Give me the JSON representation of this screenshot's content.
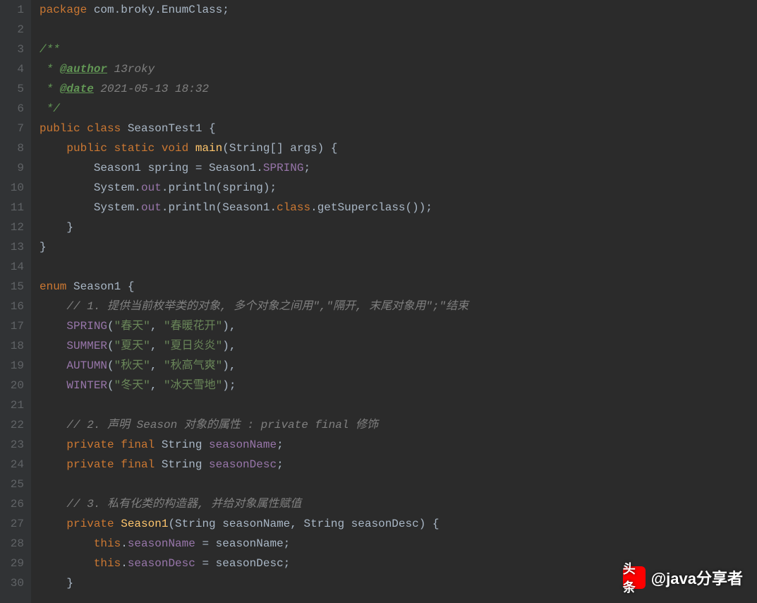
{
  "code": {
    "lines": [
      {
        "n": 1,
        "tokens": [
          [
            "kw",
            "package"
          ],
          [
            "punct",
            " com.broky.EnumClass;"
          ]
        ]
      },
      {
        "n": 2,
        "tokens": []
      },
      {
        "n": 3,
        "tokens": [
          [
            "doc",
            "/**"
          ]
        ]
      },
      {
        "n": 4,
        "tokens": [
          [
            "doc",
            " * "
          ],
          [
            "doctag",
            "@author"
          ],
          [
            "docval",
            " 13roky"
          ]
        ]
      },
      {
        "n": 5,
        "tokens": [
          [
            "doc",
            " * "
          ],
          [
            "doctag",
            "@date"
          ],
          [
            "docval",
            " 2021-05-13 18:32"
          ]
        ]
      },
      {
        "n": 6,
        "tokens": [
          [
            "doc",
            " */"
          ]
        ]
      },
      {
        "n": 7,
        "tokens": [
          [
            "kw",
            "public class "
          ],
          [
            "cls",
            "SeasonTest1"
          ],
          [
            "punct",
            " {"
          ]
        ]
      },
      {
        "n": 8,
        "tokens": [
          [
            "punct",
            "    "
          ],
          [
            "kw",
            "public static void "
          ],
          [
            "method",
            "main"
          ],
          [
            "punct",
            "(String[] args) {"
          ]
        ]
      },
      {
        "n": 9,
        "tokens": [
          [
            "punct",
            "        Season1 spring = Season1."
          ],
          [
            "const",
            "SPRING"
          ],
          [
            "punct",
            ";"
          ]
        ]
      },
      {
        "n": 10,
        "tokens": [
          [
            "punct",
            "        System."
          ],
          [
            "field",
            "out"
          ],
          [
            "punct",
            ".println(spring);"
          ]
        ]
      },
      {
        "n": 11,
        "tokens": [
          [
            "punct",
            "        System."
          ],
          [
            "field",
            "out"
          ],
          [
            "punct",
            ".println(Season1."
          ],
          [
            "kw",
            "class"
          ],
          [
            "punct",
            ".getSuperclass());"
          ]
        ]
      },
      {
        "n": 12,
        "tokens": [
          [
            "punct",
            "    }"
          ]
        ]
      },
      {
        "n": 13,
        "tokens": [
          [
            "punct",
            "}"
          ]
        ]
      },
      {
        "n": 14,
        "tokens": []
      },
      {
        "n": 15,
        "tokens": [
          [
            "kw",
            "enum "
          ],
          [
            "cls",
            "Season1"
          ],
          [
            "punct",
            " {"
          ]
        ]
      },
      {
        "n": 16,
        "tokens": [
          [
            "punct",
            "    "
          ],
          [
            "comment",
            "// 1. 提供当前枚举类的对象, 多个对象之间用\",\"隔开, 末尾对象用\";\"结束"
          ]
        ]
      },
      {
        "n": 17,
        "tokens": [
          [
            "punct",
            "    "
          ],
          [
            "const",
            "SPRING"
          ],
          [
            "punct",
            "("
          ],
          [
            "str",
            "\"春天\""
          ],
          [
            "punct",
            ", "
          ],
          [
            "str",
            "\"春暖花开\""
          ],
          [
            "punct",
            "),"
          ]
        ]
      },
      {
        "n": 18,
        "tokens": [
          [
            "punct",
            "    "
          ],
          [
            "const",
            "SUMMER"
          ],
          [
            "punct",
            "("
          ],
          [
            "str",
            "\"夏天\""
          ],
          [
            "punct",
            ", "
          ],
          [
            "str",
            "\"夏日炎炎\""
          ],
          [
            "punct",
            "),"
          ]
        ]
      },
      {
        "n": 19,
        "tokens": [
          [
            "punct",
            "    "
          ],
          [
            "const",
            "AUTUMN"
          ],
          [
            "punct",
            "("
          ],
          [
            "str",
            "\"秋天\""
          ],
          [
            "punct",
            ", "
          ],
          [
            "str",
            "\"秋高气爽\""
          ],
          [
            "punct",
            "),"
          ]
        ]
      },
      {
        "n": 20,
        "tokens": [
          [
            "punct",
            "    "
          ],
          [
            "const",
            "WINTER"
          ],
          [
            "punct",
            "("
          ],
          [
            "str",
            "\"冬天\""
          ],
          [
            "punct",
            ", "
          ],
          [
            "str",
            "\"冰天雪地\""
          ],
          [
            "punct",
            ");"
          ]
        ]
      },
      {
        "n": 21,
        "tokens": []
      },
      {
        "n": 22,
        "tokens": [
          [
            "punct",
            "    "
          ],
          [
            "comment",
            "// 2. 声明 Season 对象的属性 : private final 修饰"
          ]
        ]
      },
      {
        "n": 23,
        "tokens": [
          [
            "punct",
            "    "
          ],
          [
            "kw",
            "private final "
          ],
          [
            "punct",
            "String "
          ],
          [
            "field",
            "seasonName"
          ],
          [
            "punct",
            ";"
          ]
        ]
      },
      {
        "n": 24,
        "tokens": [
          [
            "punct",
            "    "
          ],
          [
            "kw",
            "private final "
          ],
          [
            "punct",
            "String "
          ],
          [
            "field",
            "seasonDesc"
          ],
          [
            "punct",
            ";"
          ]
        ]
      },
      {
        "n": 25,
        "tokens": []
      },
      {
        "n": 26,
        "tokens": [
          [
            "punct",
            "    "
          ],
          [
            "comment",
            "// 3. 私有化类的构造器, 并给对象属性赋值"
          ]
        ]
      },
      {
        "n": 27,
        "tokens": [
          [
            "punct",
            "    "
          ],
          [
            "kw",
            "private "
          ],
          [
            "method",
            "Season1"
          ],
          [
            "punct",
            "(String seasonName, String seasonDesc) {"
          ]
        ]
      },
      {
        "n": 28,
        "tokens": [
          [
            "punct",
            "        "
          ],
          [
            "kw",
            "this"
          ],
          [
            "punct",
            "."
          ],
          [
            "field",
            "seasonName"
          ],
          [
            "punct",
            " = seasonName;"
          ]
        ]
      },
      {
        "n": 29,
        "tokens": [
          [
            "punct",
            "        "
          ],
          [
            "kw",
            "this"
          ],
          [
            "punct",
            "."
          ],
          [
            "field",
            "seasonDesc"
          ],
          [
            "punct",
            " = seasonDesc;"
          ]
        ]
      },
      {
        "n": 30,
        "tokens": [
          [
            "punct",
            "    }"
          ]
        ]
      }
    ]
  },
  "watermark": {
    "icon_label": "头条",
    "text": "@java分享者"
  }
}
